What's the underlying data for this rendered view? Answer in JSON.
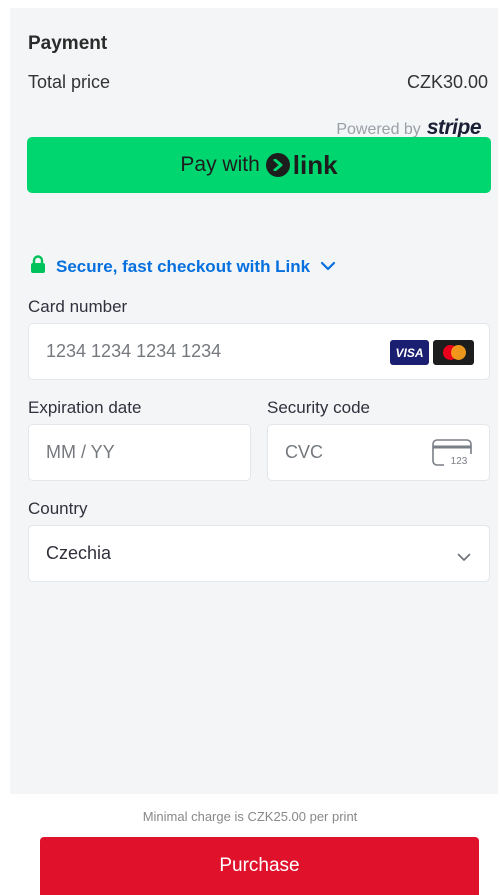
{
  "payment": {
    "title": "Payment",
    "total_label": "Total price",
    "total_value": "CZK30.00",
    "powered_by": "Powered by",
    "stripe_logo": "stripe"
  },
  "link_button": {
    "label": "Pay with",
    "brand": "link"
  },
  "secure": {
    "text": "Secure, fast checkout with Link"
  },
  "card_number": {
    "label": "Card number",
    "placeholder": "1234 1234 1234 1234",
    "brands": [
      "VISA",
      "Mastercard"
    ]
  },
  "expiration": {
    "label": "Expiration date",
    "placeholder": "MM / YY"
  },
  "security_code": {
    "label": "Security code",
    "placeholder": "CVC",
    "icon_text": "123"
  },
  "country": {
    "label": "Country",
    "value": "Czechia"
  },
  "footer": {
    "min_charge": "Minimal charge is CZK25.00 per print",
    "purchase_label": "Purchase"
  },
  "colors": {
    "link_green": "#00d66f",
    "secure_blue": "#0570de",
    "purchase_red": "#e0112b",
    "panel_bg": "#f3f5f7"
  }
}
